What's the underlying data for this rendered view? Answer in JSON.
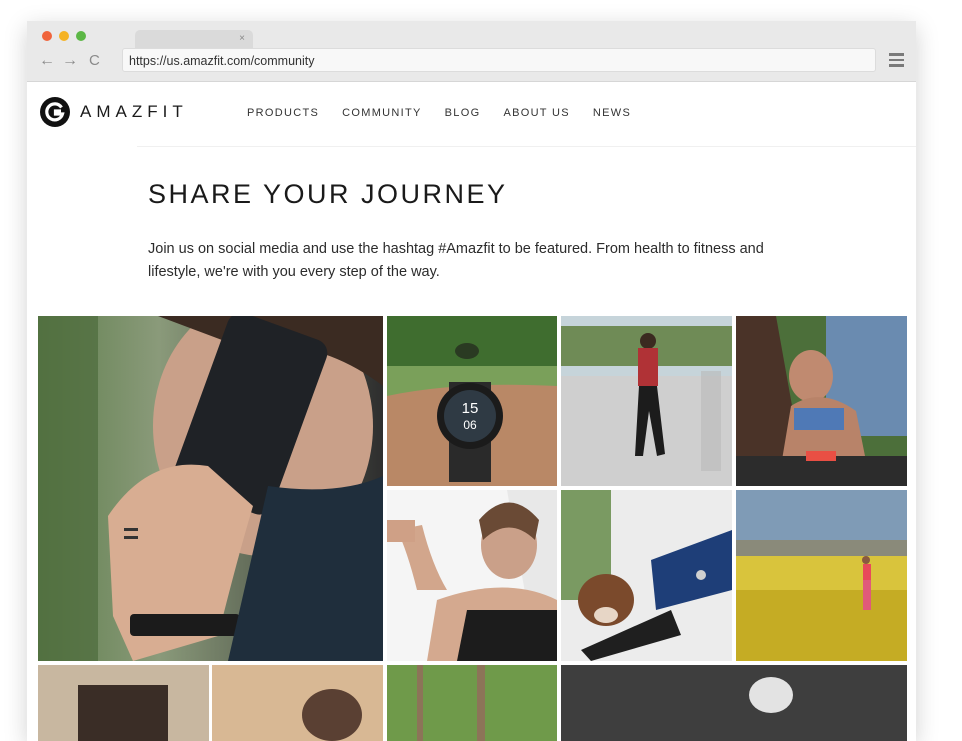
{
  "browser": {
    "tab_close": "×",
    "back_glyph": "←",
    "forward_glyph": "→",
    "reload_glyph": "C",
    "url": "https://us.amazfit.com/community"
  },
  "site": {
    "logo_text": "AMAZFIT",
    "nav": [
      "PRODUCTS",
      "COMMUNITY",
      "BLOG",
      "ABOUT US",
      "NEWS"
    ]
  },
  "content": {
    "headline": "SHARE YOUR JOURNEY",
    "intro": "Join us on social media and use the hashtag #Amazfit to be featured. From health to fitness and lifestyle, we're with you every step of the way."
  },
  "gallery": {
    "watch_hour": "15",
    "watch_minute": "06"
  },
  "colors": {
    "traffic_red": "#f0643c",
    "traffic_yellow": "#f5b324",
    "traffic_green": "#5cb746"
  }
}
